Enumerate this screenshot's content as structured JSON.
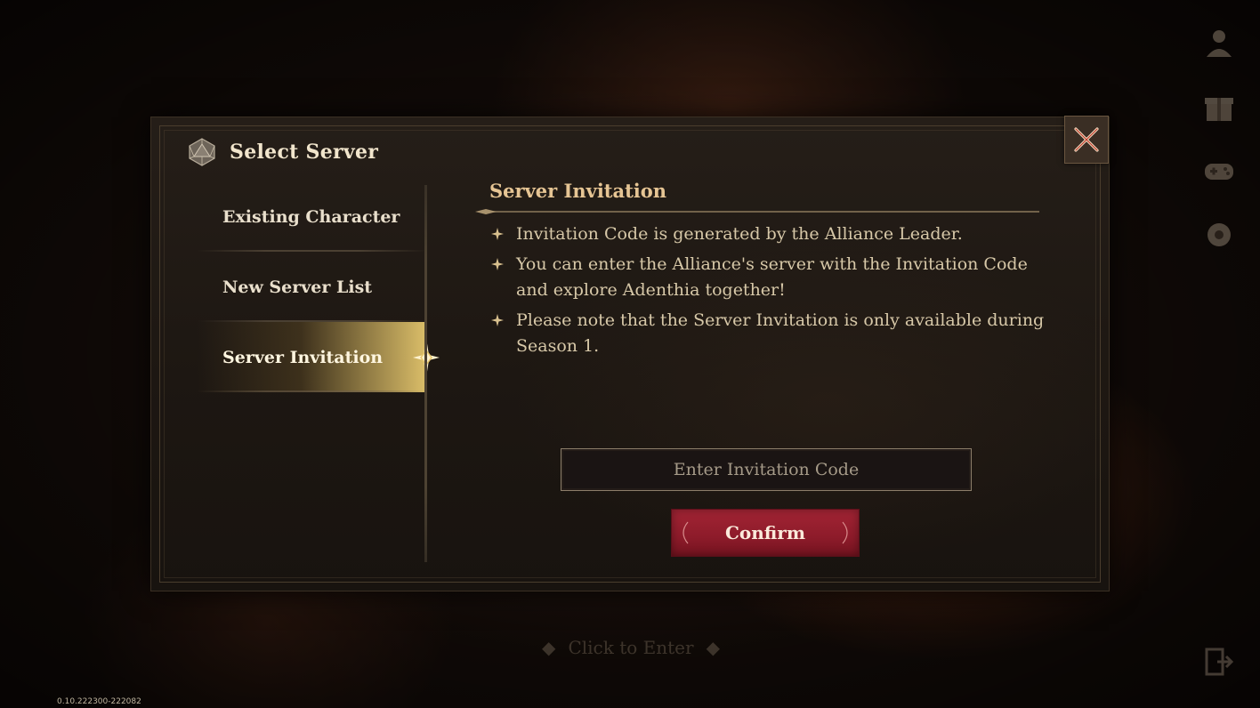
{
  "dialog": {
    "title": "Select Server",
    "close_icon": "close-x-icon"
  },
  "nav": {
    "items": [
      {
        "label": "Existing Character",
        "active": false
      },
      {
        "label": "New Server List",
        "active": false
      },
      {
        "label": "Server Invitation",
        "active": true
      }
    ]
  },
  "content": {
    "title": "Server Invitation",
    "bullets": [
      "Invitation Code is generated by the Alliance Leader.",
      "You can enter the Alliance's server with the Invitation Code and explore Adenthia together!",
      "Please note that the Server Invitation is only available during Season 1."
    ],
    "input": {
      "value": "",
      "placeholder": "Enter Invitation Code"
    },
    "confirm_label": "Confirm"
  },
  "background": {
    "click_to_enter": "Click to Enter",
    "version": "0.10.222300-222082"
  },
  "side_icons": [
    "profile-icon",
    "gift-box-icon",
    "gamepad-icon",
    "settings-gear-icon",
    "exit-icon"
  ],
  "colors": {
    "accent_gold": "#e6c594",
    "confirm_red": "#9b2131",
    "active_tab_glow": "#e6c86e"
  }
}
